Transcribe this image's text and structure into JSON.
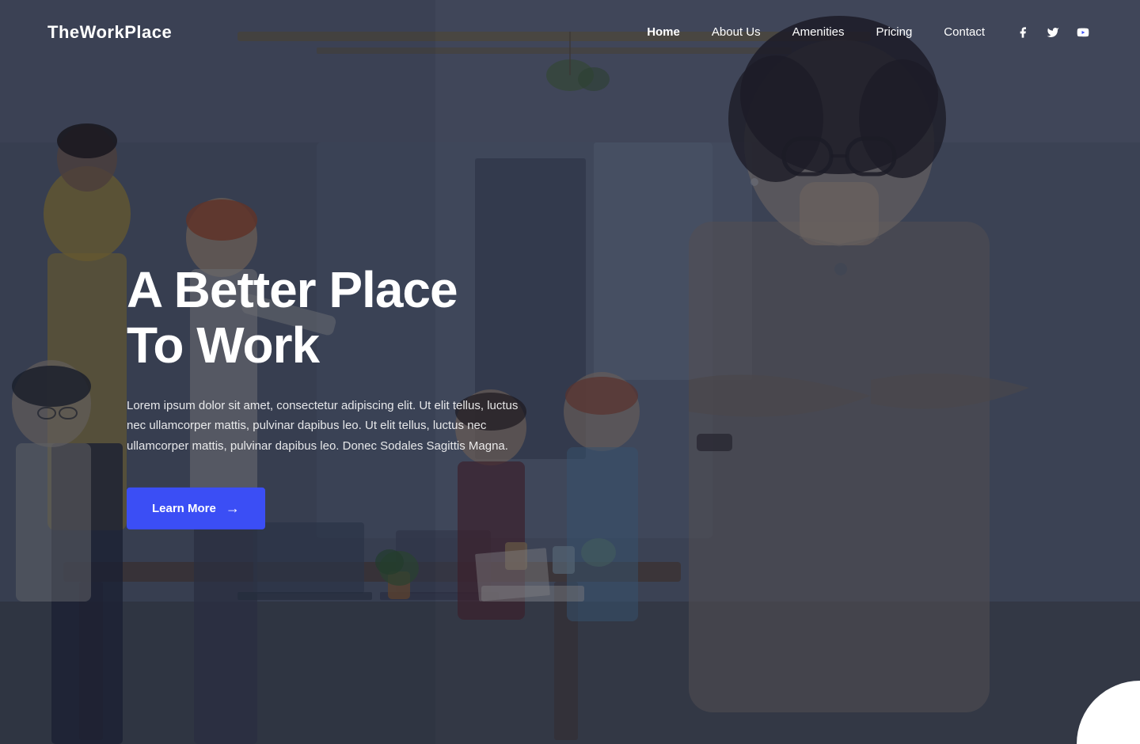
{
  "brand": {
    "logo": "TheWorkPlace"
  },
  "nav": {
    "links": [
      {
        "label": "Home",
        "active": true,
        "id": "home"
      },
      {
        "label": "About Us",
        "active": false,
        "id": "about"
      },
      {
        "label": "Amenities",
        "active": false,
        "id": "amenities"
      },
      {
        "label": "Pricing",
        "active": false,
        "id": "pricing"
      },
      {
        "label": "Contact",
        "active": false,
        "id": "contact"
      }
    ],
    "social": [
      {
        "name": "facebook",
        "icon": "f",
        "unicode": "f"
      },
      {
        "name": "twitter",
        "icon": "t",
        "unicode": "t"
      },
      {
        "name": "youtube",
        "icon": "y",
        "unicode": "▶"
      }
    ]
  },
  "hero": {
    "title_line1": "A Better Place",
    "title_line2": "To Work",
    "description": "Lorem ipsum dolor sit amet, consectetur adipiscing elit. Ut elit tellus, luctus nec ullamcorper mattis, pulvinar dapibus leo. Ut elit tellus, luctus nec ullamcorper mattis, pulvinar dapibus leo. Donec Sodales Sagittis Magna.",
    "cta_label": "Learn More",
    "cta_arrow": "→"
  },
  "colors": {
    "accent": "#3b4ef5",
    "nav_bg": "transparent",
    "overlay": "rgba(30,40,65,0.55)"
  }
}
